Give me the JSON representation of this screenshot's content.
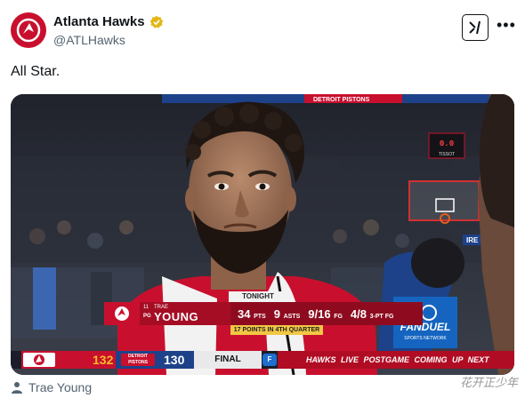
{
  "author": {
    "display_name": "Atlanta Hawks",
    "handle": "@ATLHawks",
    "verified_badge_icon": "gold-verified-check-icon",
    "brand_color": "#c8102e"
  },
  "post": {
    "text": "All Star."
  },
  "media": {
    "broadcast": {
      "tonight_tag": "TONIGHT",
      "player_number": "11",
      "player_position": "PG",
      "player_first": "TRAE",
      "player_last": "YOUNG",
      "pts": "34",
      "pts_unit": "PTS",
      "asts": "9",
      "asts_unit": "ASTS",
      "fg": "9/16",
      "fg_unit": "FG",
      "threes": "4/8",
      "threes_unit": "3-PT FG",
      "note": "17 POINTS IN 4TH QUARTER",
      "shot_clock": "0.0",
      "shot_clock_brand": "TISSOT",
      "mic_brand": "FANDUEL",
      "mic_sub": "SPORTS NETWORK",
      "arena_banner": "DETROIT PISTONS",
      "arena_ad": "IRE"
    },
    "scoreboard": {
      "team_a_score": "132",
      "team_b_label": "DETROIT PISTONS",
      "team_b_score": "130",
      "status": "FINAL",
      "promo": "HAWKS LIVE POSTGAME  COMING UP NEXT"
    }
  },
  "tagged": {
    "icon": "person-icon",
    "label": "Trae Young"
  },
  "watermark": "花开正少年"
}
